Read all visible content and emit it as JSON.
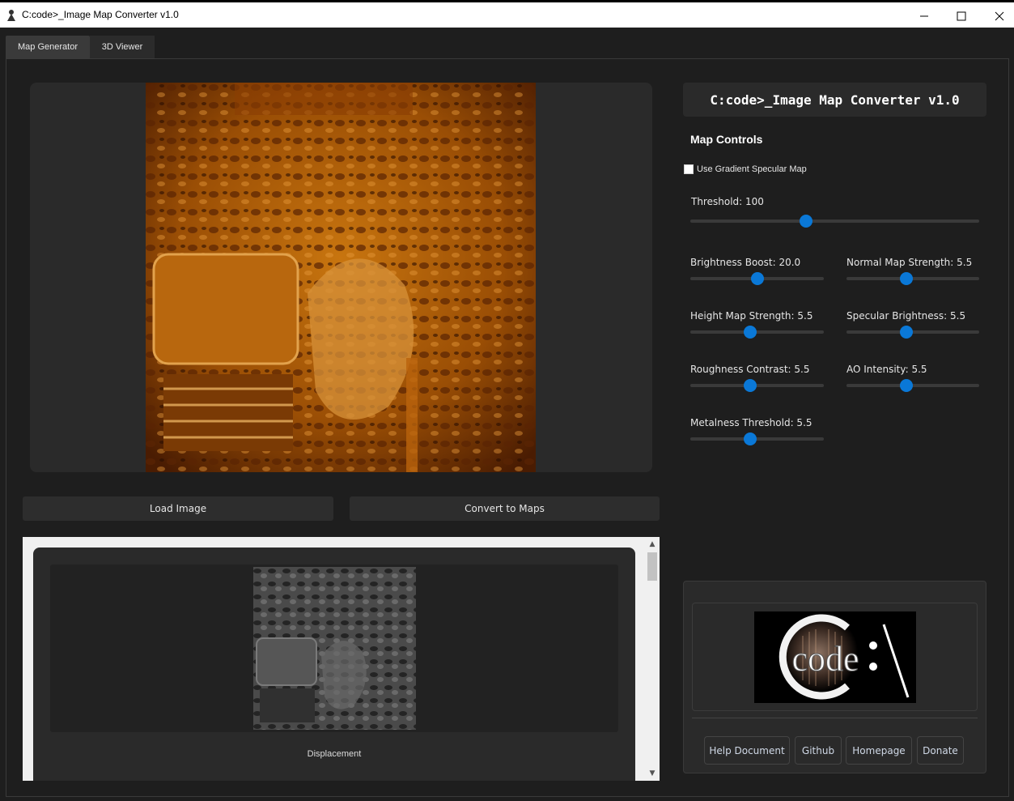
{
  "window": {
    "title": "C:code>_Image Map Converter v1.0",
    "minimize": "—",
    "maximize": "☐",
    "close": "✕"
  },
  "tabs": [
    {
      "label": "Map Generator",
      "active": true
    },
    {
      "label": "3D Viewer",
      "active": false
    }
  ],
  "buttons": {
    "load": "Load Image",
    "convert": "Convert to Maps"
  },
  "map_card": {
    "label": "Displacement"
  },
  "scroll": {
    "up": "▲",
    "down": "▼"
  },
  "panel": {
    "banner": "C:code>_Image Map Converter v1.0",
    "controls_title": "Map Controls",
    "gradient_label": "Use Gradient Specular Map",
    "gradient_checked": false
  },
  "sliders": {
    "threshold": {
      "label": "Threshold: 100",
      "fraction": 0.4
    },
    "brightness": {
      "label": "Brightness Boost: 20.0",
      "fraction": 0.5
    },
    "normal": {
      "label": "Normal Map Strength: 5.5",
      "fraction": 0.45
    },
    "height": {
      "label": "Height Map Strength: 5.5",
      "fraction": 0.45
    },
    "specular": {
      "label": "Specular Brightness: 5.5",
      "fraction": 0.45
    },
    "roughness": {
      "label": "Roughness Contrast: 5.5",
      "fraction": 0.45
    },
    "ao": {
      "label": "AO Intensity: 5.5",
      "fraction": 0.45
    },
    "metalness": {
      "label": "Metalness Threshold: 5.5",
      "fraction": 0.45
    }
  },
  "logo": {
    "text": "code"
  },
  "footer_buttons": {
    "help": "Help Document",
    "github": "Github",
    "homepage": "Homepage",
    "donate": "Donate"
  },
  "colors": {
    "accent": "#0a78d7",
    "background": "#1e1e1e",
    "panel": "#2a2a2a"
  }
}
